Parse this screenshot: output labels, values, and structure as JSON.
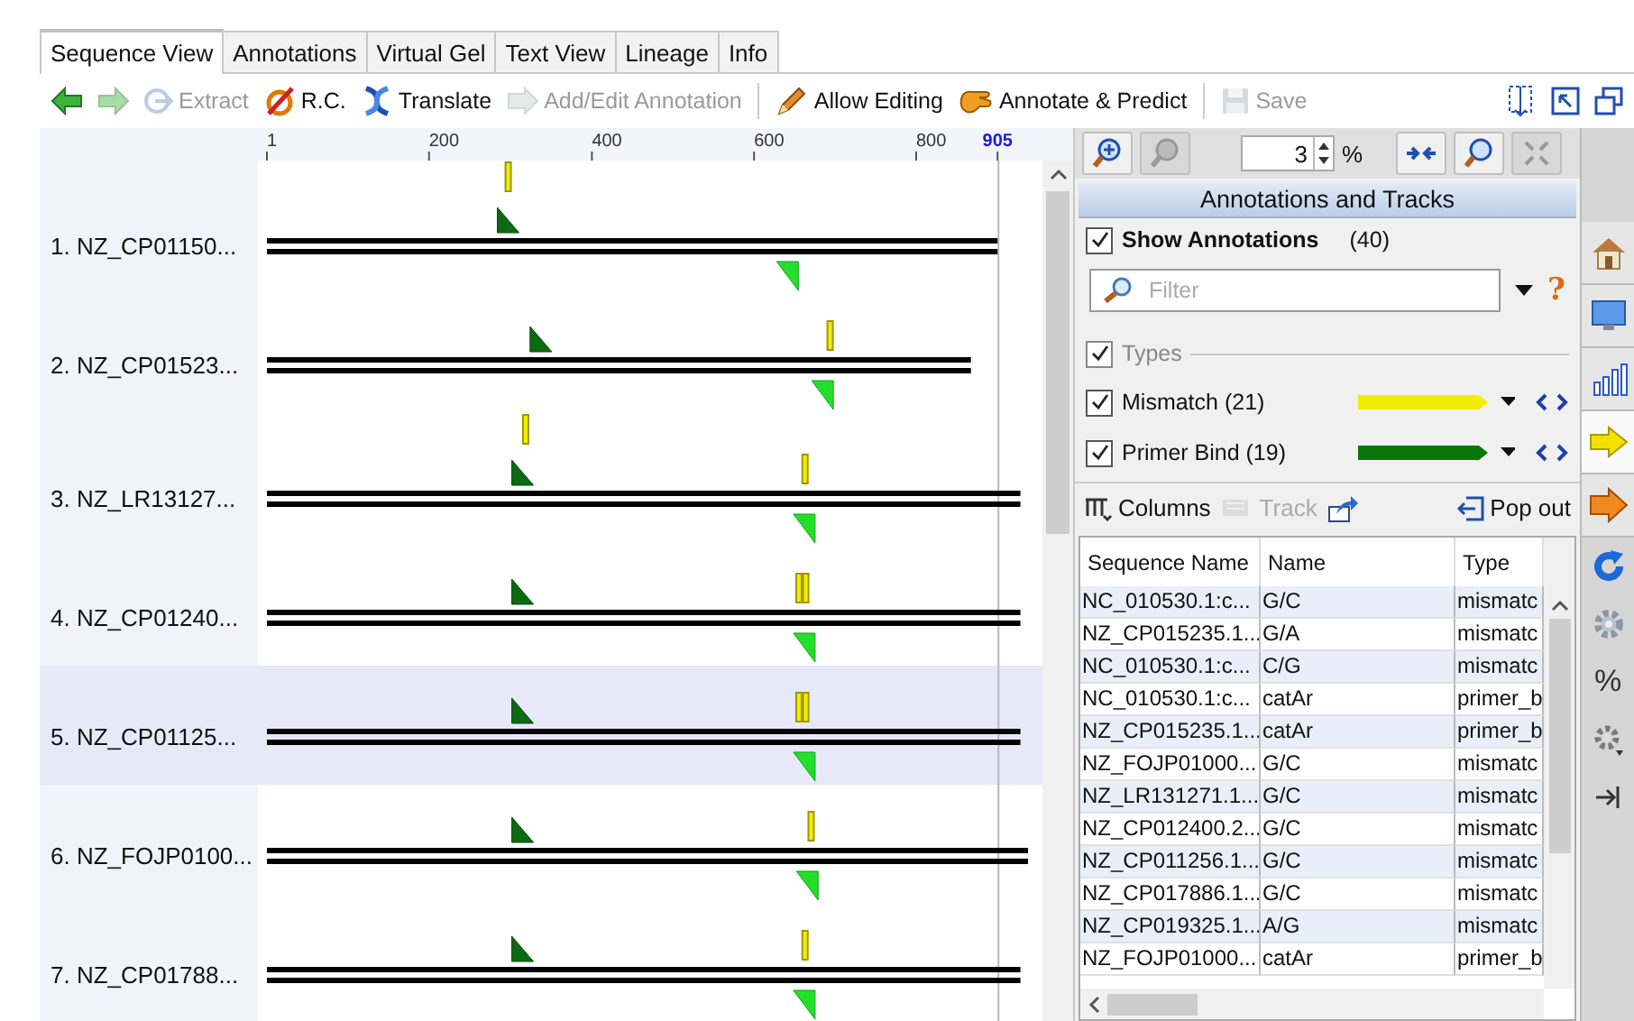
{
  "tabs": [
    {
      "label": "Sequence View",
      "selected": true
    },
    {
      "label": "Annotations",
      "selected": false
    },
    {
      "label": "Virtual Gel",
      "selected": false
    },
    {
      "label": "Text View",
      "selected": false
    },
    {
      "label": "Lineage",
      "selected": false
    },
    {
      "label": "Info",
      "selected": false
    }
  ],
  "toolbar": [
    {
      "kind": "button",
      "disabled": false
    },
    {
      "kind": "button",
      "disabled": true
    },
    {
      "kind": "button",
      "label": "Extract",
      "disabled": true
    },
    {
      "kind": "button",
      "label": "R.C.",
      "disabled": false
    },
    {
      "kind": "button",
      "label": "Translate",
      "disabled": false
    },
    {
      "kind": "button",
      "label": "Add/Edit Annotation",
      "disabled": true
    },
    {
      "kind": "separator"
    },
    {
      "kind": "button",
      "label": "Allow Editing",
      "disabled": false
    },
    {
      "kind": "button",
      "label": "Annotate & Predict",
      "disabled": false
    },
    {
      "kind": "separator"
    },
    {
      "kind": "button",
      "label": "Save",
      "disabled": true
    }
  ],
  "toolbar_right": [
    {
      "disabled": false
    },
    {
      "disabled": false
    },
    {
      "disabled": false
    }
  ],
  "ruler": [
    {
      "label": "1",
      "level": 0,
      "kind": "tick"
    },
    {
      "label": "200",
      "level": 0.213,
      "kind": "tick"
    },
    {
      "label": "400",
      "level": 0.427,
      "kind": "tick"
    },
    {
      "label": "600",
      "level": 0.64,
      "kind": "tick"
    },
    {
      "label": "800",
      "level": 0.853,
      "kind": "tick"
    },
    {
      "label": "905",
      "level": 0.96,
      "kind": "end"
    }
  ],
  "sequences": [
    {
      "name": "1. NZ_CP01150...",
      "selected": false,
      "level": 0.96,
      "annotations": [
        {
          "kind": "mismatch_upper",
          "level": 0.317
        },
        {
          "kind": "primer_forward",
          "level": 0.317
        },
        {
          "kind": "primer_reverse",
          "level": 0.684
        }
      ]
    },
    {
      "name": "2. NZ_CP01523...",
      "selected": false,
      "level": 0.925,
      "annotations": [
        {
          "kind": "primer_forward",
          "level": 0.36
        },
        {
          "kind": "mismatch",
          "level": 0.74
        },
        {
          "kind": "primer_reverse",
          "level": 0.73
        }
      ]
    },
    {
      "name": "3. NZ_LR13127...",
      "selected": false,
      "level": 0.99,
      "annotations": [
        {
          "kind": "mismatch_upper",
          "level": 0.34
        },
        {
          "kind": "primer_forward",
          "level": 0.336
        },
        {
          "kind": "mismatch",
          "level": 0.707
        },
        {
          "kind": "primer_reverse",
          "level": 0.706
        }
      ]
    },
    {
      "name": "4. NZ_CP01240...",
      "selected": false,
      "level": 0.99,
      "annotations": [
        {
          "kind": "primer_forward",
          "level": 0.336
        },
        {
          "kind": "mismatch",
          "level": 0.699
        },
        {
          "kind": "mismatch",
          "level": 0.708
        },
        {
          "kind": "primer_reverse",
          "level": 0.706
        }
      ]
    },
    {
      "name": "5. NZ_CP01125...",
      "selected": true,
      "level": 0.99,
      "annotations": [
        {
          "kind": "primer_forward",
          "level": 0.336
        },
        {
          "kind": "mismatch",
          "level": 0.699
        },
        {
          "kind": "mismatch",
          "level": 0.708
        },
        {
          "kind": "primer_reverse",
          "level": 0.706
        }
      ]
    },
    {
      "name": "6. NZ_FOJP0100...",
      "selected": false,
      "level": 1,
      "annotations": [
        {
          "kind": "primer_forward",
          "level": 0.336
        },
        {
          "kind": "mismatch",
          "level": 0.715
        },
        {
          "kind": "primer_reverse",
          "level": 0.71
        }
      ]
    },
    {
      "name": "7. NZ_CP01788...",
      "selected": false,
      "level": 0.99,
      "annotations": [
        {
          "kind": "primer_forward",
          "level": 0.336
        },
        {
          "kind": "mismatch",
          "level": 0.707
        },
        {
          "kind": "primer_reverse",
          "level": 0.706
        }
      ]
    }
  ],
  "zoom": {
    "value": "3",
    "unit": "%"
  },
  "panel_title": "Annotations and Tracks",
  "show_annotations": {
    "label": "Show Annotations",
    "checked": true,
    "count": "(40)"
  },
  "filter": {
    "placeholder": "Filter",
    "help": "?"
  },
  "types": {
    "label": "Types",
    "checked": true
  },
  "tracks": [
    {
      "label": "Mismatch (21)",
      "checked": true,
      "color": "#f2ee00"
    },
    {
      "label": "Primer Bind (19)",
      "checked": true,
      "color": "#0a760a"
    }
  ],
  "table_toolbar": [
    {
      "label": "Columns",
      "disabled": false
    },
    {
      "label": "Track",
      "disabled": true
    },
    {
      "disabled": false
    },
    {
      "label": "Pop out",
      "disabled": false
    }
  ],
  "table": {
    "columns": [
      "Sequence Name",
      "Name",
      "Type"
    ],
    "rows": [
      [
        "NC_010530.1:c...",
        "G/C",
        "mismatc"
      ],
      [
        "NZ_CP015235.1...",
        "G/A",
        "mismatc"
      ],
      [
        "NC_010530.1:c...",
        "C/G",
        "mismatc"
      ],
      [
        "NC_010530.1:c...",
        "catAr",
        "primer_b"
      ],
      [
        "NZ_CP015235.1...",
        "catAr",
        "primer_b"
      ],
      [
        "NZ_FOJP01000...",
        "G/C",
        "mismatc"
      ],
      [
        "NZ_LR131271.1...",
        "G/C",
        "mismatc"
      ],
      [
        "NZ_CP012400.2...",
        "G/C",
        "mismatc"
      ],
      [
        "NZ_CP011256.1...",
        "G/C",
        "mismatc"
      ],
      [
        "NZ_CP017886.1...",
        "G/C",
        "mismatc"
      ],
      [
        "NZ_CP019325.1...",
        "A/G",
        "mismatc"
      ],
      [
        "NZ_FOJP01000...",
        "catAr",
        "primer_b"
      ]
    ]
  },
  "side_tabs": [
    {
      "selected": false
    },
    {
      "selected": false
    },
    {
      "selected": false
    },
    {
      "selected": true
    },
    {
      "selected": false
    },
    {
      "selected": false
    },
    {
      "selected": false
    },
    {
      "selected": false,
      "label": "%"
    },
    {
      "selected": false
    },
    {
      "selected": false
    }
  ]
}
